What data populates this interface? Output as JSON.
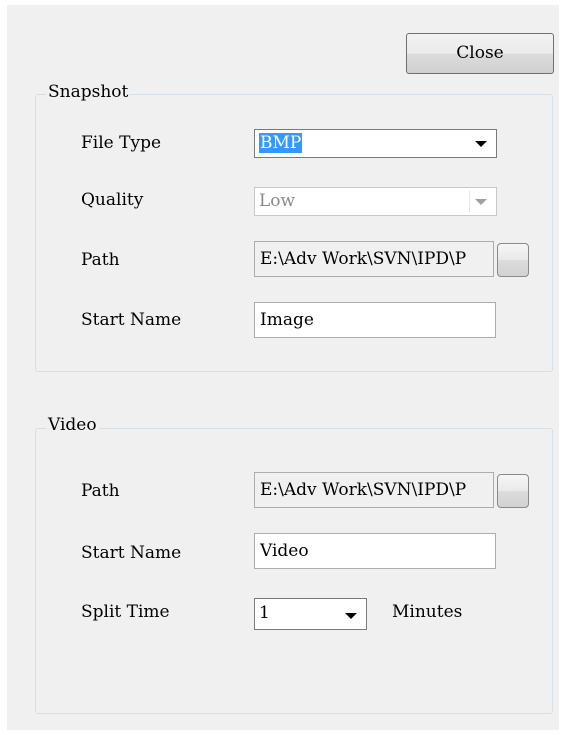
{
  "toolbar": {
    "close_label": "Close"
  },
  "snapshot": {
    "legend": "Snapshot",
    "file_type_label": "File Type",
    "file_type_value": "BMP",
    "quality_label": "Quality",
    "quality_value": "Low",
    "path_label": "Path",
    "path_value": "E:\\Adv Work\\SVN\\IPD\\P",
    "start_name_label": "Start Name",
    "start_name_value": "Image"
  },
  "video": {
    "legend": "Video",
    "path_label": "Path",
    "path_value": "E:\\Adv Work\\SVN\\IPD\\P",
    "start_name_label": "Start Name",
    "start_name_value": "Video",
    "split_time_label": "Split Time",
    "split_time_value": "1",
    "split_time_unit": "Minutes"
  }
}
